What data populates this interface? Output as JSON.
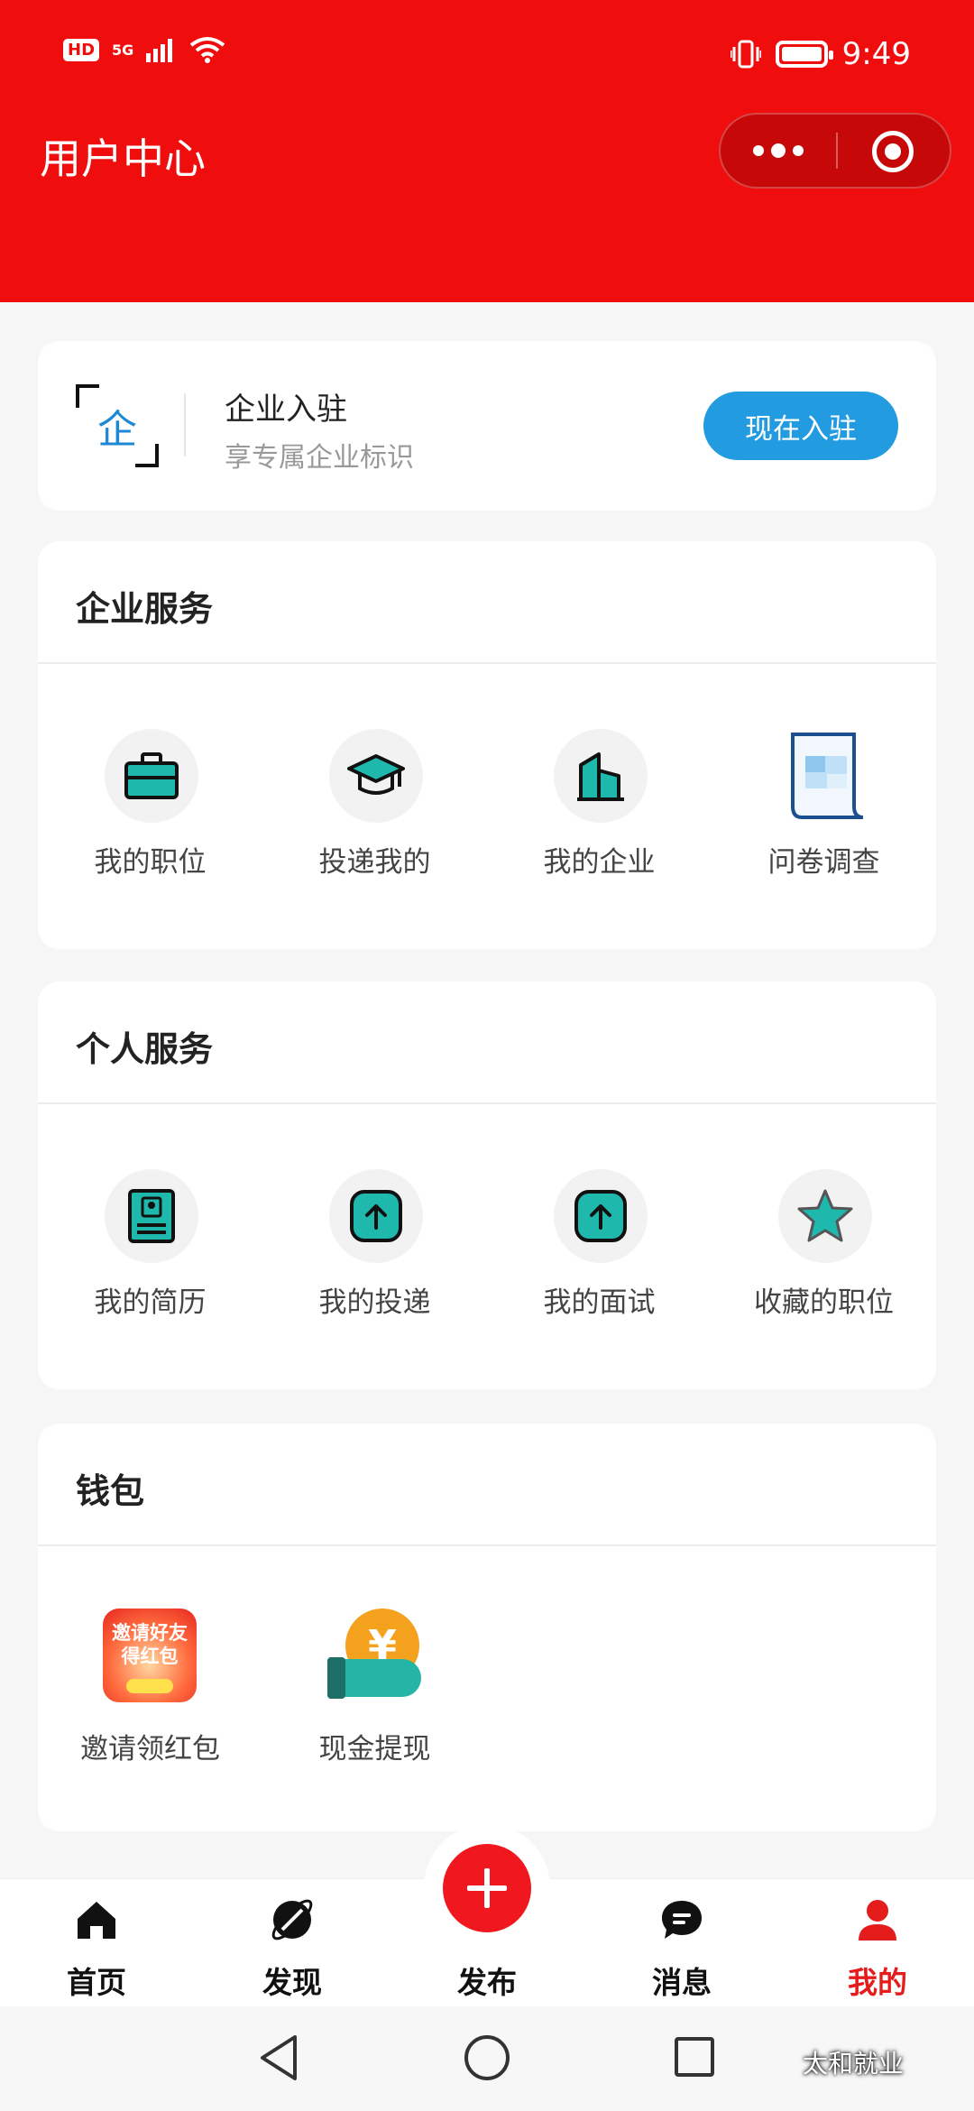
{
  "status_bar": {
    "left_badge": "HD",
    "network": "5G",
    "time": "9:49"
  },
  "header": {
    "title": "用户中心"
  },
  "join_card": {
    "icon_char": "企",
    "title": "企业入驻",
    "subtitle": "享专属企业标识",
    "button": "现在入驻"
  },
  "enterprise_services": {
    "title": "企业服务",
    "items": [
      {
        "label": "我的职位",
        "icon": "briefcase-icon"
      },
      {
        "label": "投递我的",
        "icon": "graduation-cap-icon"
      },
      {
        "label": "我的企业",
        "icon": "building-icon"
      },
      {
        "label": "问卷调查",
        "icon": "survey-scroll-icon"
      }
    ]
  },
  "personal_services": {
    "title": "个人服务",
    "items": [
      {
        "label": "我的简历",
        "icon": "resume-icon"
      },
      {
        "label": "我的投递",
        "icon": "upload-arrow-icon"
      },
      {
        "label": "我的面试",
        "icon": "upload-arrow-icon"
      },
      {
        "label": "收藏的职位",
        "icon": "star-icon"
      }
    ]
  },
  "wallet": {
    "title": "钱包",
    "items": [
      {
        "label": "邀请领红包",
        "icon": "red-packet-icon",
        "art_text": "邀请好友\n得红包"
      },
      {
        "label": "现金提现",
        "icon": "cash-withdraw-icon",
        "art_text": "¥"
      }
    ]
  },
  "tabbar": {
    "items": [
      {
        "label": "首页",
        "icon": "home-icon"
      },
      {
        "label": "发现",
        "icon": "discover-icon"
      },
      {
        "label": "发布",
        "icon": "plus-icon"
      },
      {
        "label": "消息",
        "icon": "message-icon"
      },
      {
        "label": "我的",
        "icon": "user-icon",
        "active": true
      }
    ],
    "active_color": "#e51c1c"
  },
  "watermark": "太和就业",
  "colors": {
    "header_red": "#f00d0d",
    "accent_blue": "#239be0",
    "teal": "#1fb8ad"
  }
}
